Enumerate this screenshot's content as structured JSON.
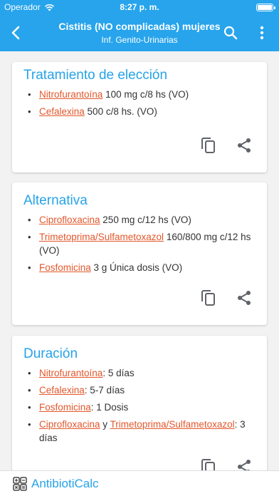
{
  "status": {
    "carrier": "Operador",
    "time": "8:27 p. m."
  },
  "header": {
    "title": "Cistitis (NO complicadas) mujeres",
    "subtitle": "Inf. Genito-Urinarias"
  },
  "cards": [
    {
      "title": "Tratamiento de elección",
      "items": [
        {
          "drug": "Nitrofurantoína",
          "text": " 100 mg c/8 hs (VO)"
        },
        {
          "drug": "Cefalexina",
          "text": " 500 c/8 hs. (VO)"
        }
      ]
    },
    {
      "title": "Alternativa",
      "items": [
        {
          "drug": "Ciprofloxacina",
          "text": " 250 mg c/12 hs (VO)"
        },
        {
          "drug": "Trimetoprima/Sulfametoxazol",
          "text": " 160/800 mg c/12 hs (VO)"
        },
        {
          "drug": "Fosfomicina",
          "text": " 3 g Única dosis (VO)"
        }
      ]
    },
    {
      "title": "Duración",
      "items": [
        {
          "drug": "Nitrofurantoína",
          "text": ": 5 días"
        },
        {
          "drug": "Cefalexina",
          "text": ": 5-7 días"
        },
        {
          "drug": "Fosfomicina",
          "text": ": 1 Dosis"
        },
        {
          "drug": "Ciprofloxacina",
          "mid": " y ",
          "drug2": "Trimetoprima/Sulfametoxazol",
          "text": ": 3 días"
        }
      ]
    }
  ],
  "bullet": "•",
  "footer": {
    "app_name": "AntibiotiCalc"
  },
  "colors": {
    "primary": "#27a4ec",
    "drug_link": "#e2572b",
    "card_title": "#26a3e8"
  },
  "icons": [
    "wifi-icon",
    "battery-icon",
    "back-arrow-icon",
    "search-icon",
    "more-vert-icon",
    "copy-icon",
    "share-icon",
    "calculator-icon"
  ]
}
